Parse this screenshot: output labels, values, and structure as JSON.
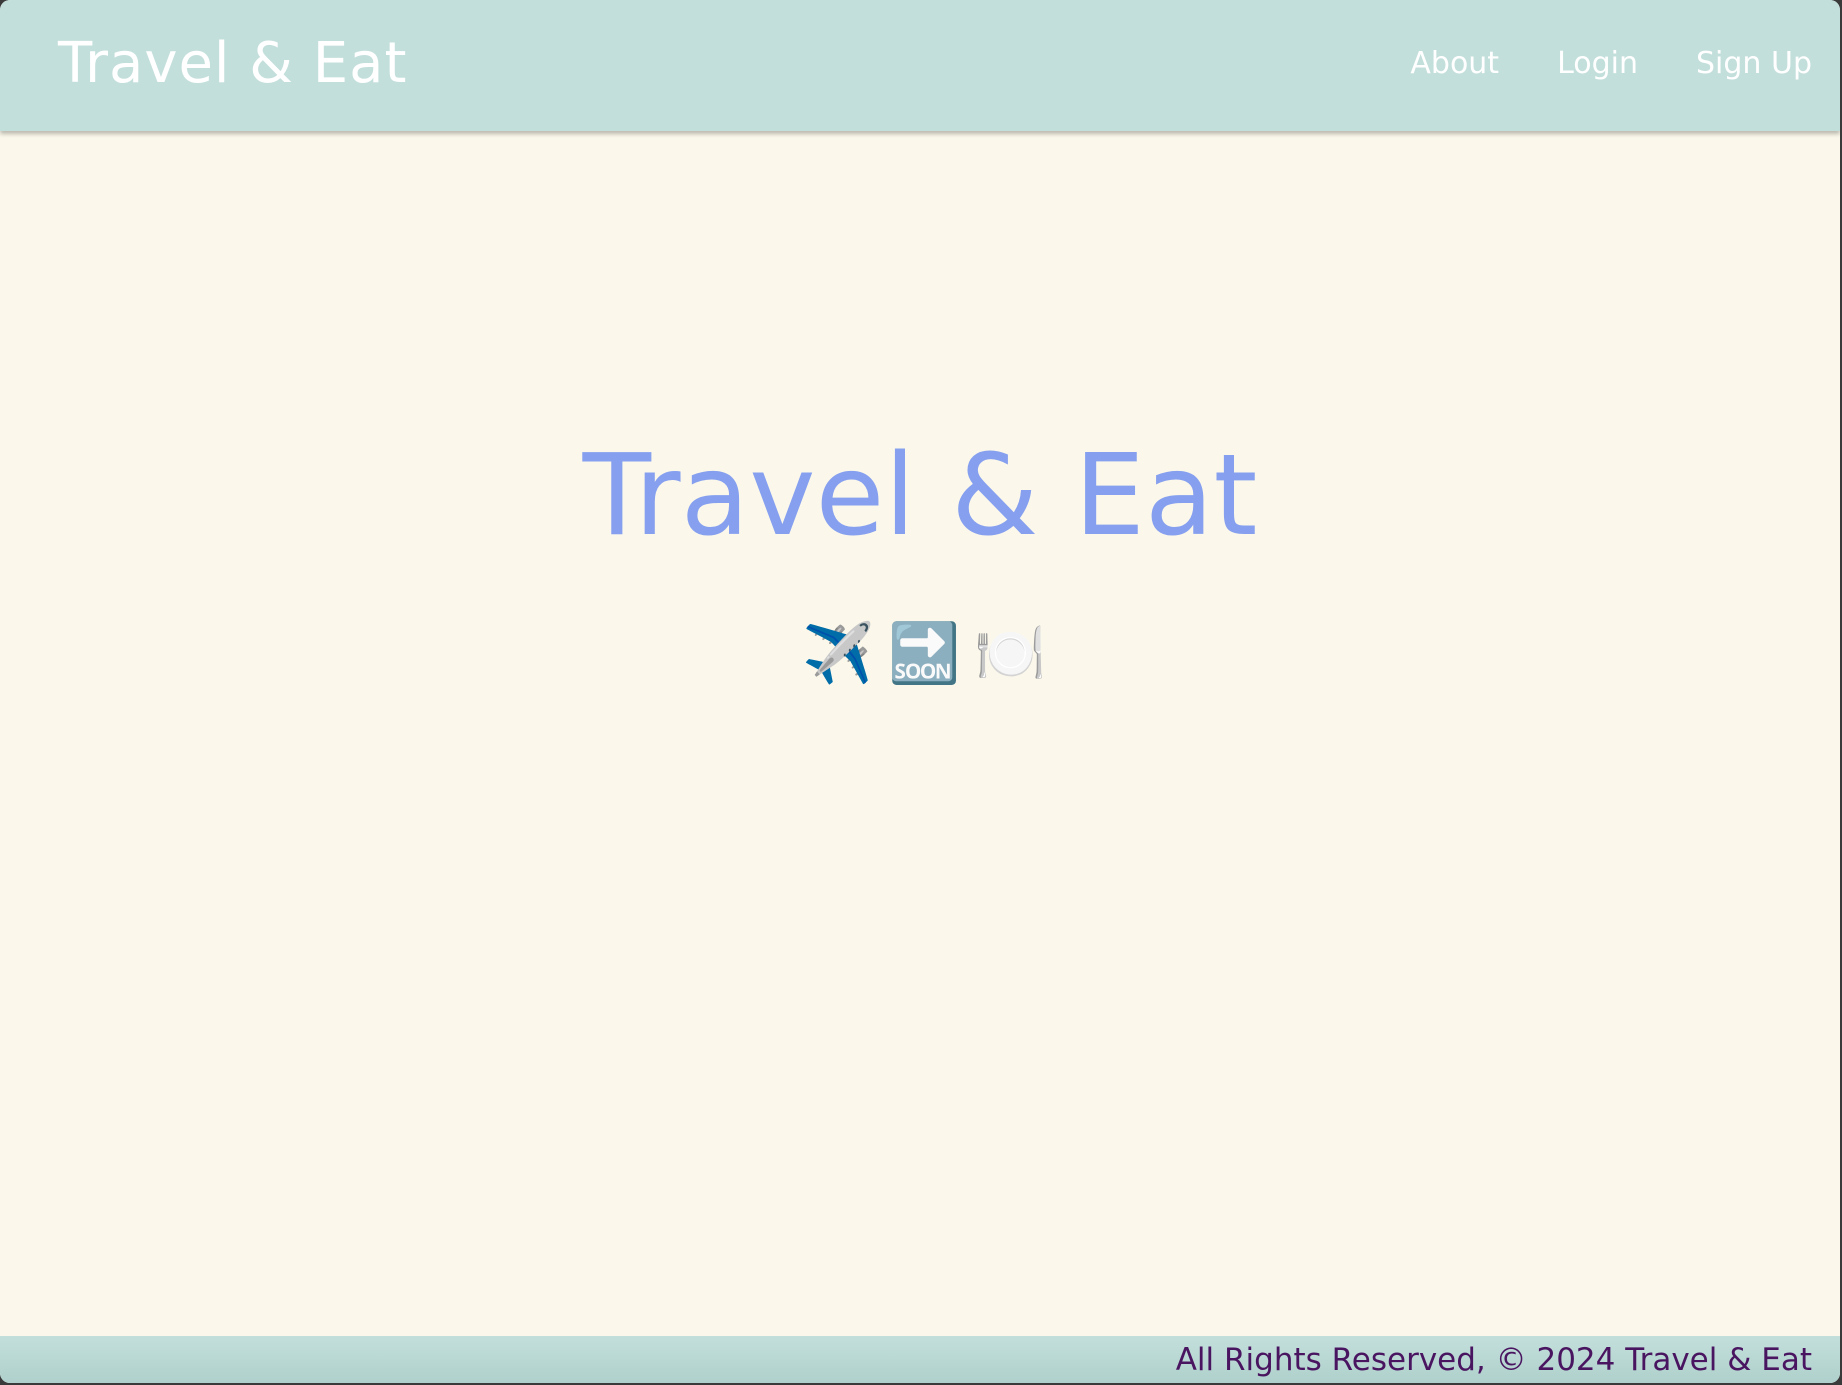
{
  "navbar": {
    "brand": "Travel & Eat",
    "links": [
      {
        "label": "About"
      },
      {
        "label": "Login"
      },
      {
        "label": "Sign Up"
      }
    ]
  },
  "hero": {
    "title": "Travel & Eat",
    "emojis": [
      {
        "glyph": "✈️",
        "icon": "airplane-icon"
      },
      {
        "glyph": "🔜",
        "icon": "soon-arrow-icon"
      },
      {
        "glyph": "🍽️",
        "icon": "plate-fork-knife-icon"
      }
    ]
  },
  "footer": {
    "text": "All Rights Reserved, © 2024 Travel & Eat"
  },
  "colors": {
    "navbar_bg": "#c3dfdb",
    "page_bg": "#fbf8eb",
    "hero_title": "#86a0ef",
    "footer_text": "#4a1560"
  }
}
